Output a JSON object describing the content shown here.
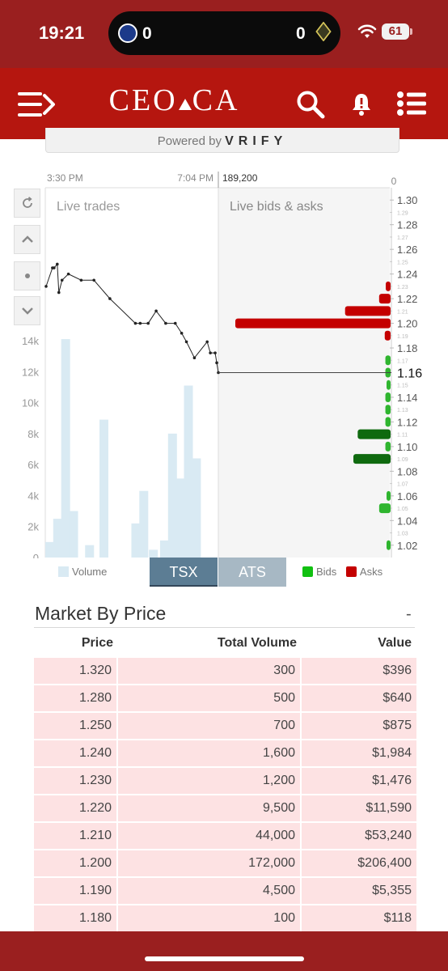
{
  "status_bar": {
    "time": "19:21",
    "score_left": "0",
    "score_right": "0",
    "battery": "61"
  },
  "app": {
    "logo_left": "CEO",
    "logo_right": "CA"
  },
  "powered_by": {
    "prefix": "Powered by",
    "brand": "VRIFY"
  },
  "chart": {
    "time_start": "3:30 PM",
    "time_end": "7:04 PM",
    "volume_readout": "189,200",
    "top_right_value": "0",
    "left_panel_label": "Live trades",
    "right_panel_label": "Live bids & asks",
    "current_price_label": "1.16",
    "volume_ticks": [
      "14k",
      "12k",
      "10k",
      "8k",
      "6k",
      "4k",
      "2k",
      "0"
    ],
    "price_ticks_major": [
      "1.30",
      "1.28",
      "1.26",
      "1.24",
      "1.22",
      "1.20",
      "1.18",
      "1.14",
      "1.12",
      "1.10",
      "1.08",
      "1.06",
      "1.04",
      "1.02"
    ],
    "price_ticks_minor": [
      "1.29",
      "1.27",
      "1.25",
      "1.23",
      "1.21",
      "1.19",
      "1.17",
      "1.15",
      "1.13",
      "1.11",
      "1.09",
      "1.07",
      "1.05",
      "1.03"
    ],
    "legend_volume": "Volume",
    "legend_bids": "Bids",
    "legend_asks": "Asks",
    "tab_tsx": "TSX",
    "tab_ats": "ATS",
    "colors": {
      "line": "#222222",
      "volume": "#d9eaf3",
      "bid": "#2fb52f",
      "bid_dark": "#0f6a0f",
      "ask": "#c40000",
      "tab_active": "#5c7d94",
      "tab_inactive": "#a7b8c4"
    }
  },
  "chart_data": {
    "type": "line",
    "price_series": {
      "x_minutes_after_1530": [
        0,
        8,
        10,
        14,
        16,
        20,
        28,
        44,
        60,
        80,
        112,
        118,
        128,
        138,
        150,
        162,
        170,
        176,
        186,
        202,
        206,
        212,
        214,
        216
      ],
      "price": [
        1.23,
        1.245,
        1.245,
        1.248,
        1.225,
        1.235,
        1.24,
        1.235,
        1.235,
        1.22,
        1.2,
        1.2,
        1.2,
        1.21,
        1.2,
        1.2,
        1.192,
        1.185,
        1.172,
        1.185,
        1.176,
        1.176,
        1.168,
        1.16
      ]
    },
    "volume_bars": {
      "x_minutes_after_1530": [
        4,
        14,
        24,
        34,
        54,
        72,
        112,
        122,
        134,
        148,
        158,
        168,
        178,
        188,
        198,
        208
      ],
      "volume": [
        1000,
        2500,
        14100,
        3000,
        800,
        8900,
        2200,
        4300,
        500,
        1100,
        8000,
        5100,
        11100,
        6400,
        0,
        0
      ]
    },
    "asks": [
      {
        "price": 1.23,
        "size": 1000
      },
      {
        "price": 1.22,
        "size": 9500
      },
      {
        "price": 1.21,
        "size": 44000
      },
      {
        "price": 1.2,
        "size": 172000
      },
      {
        "price": 1.19,
        "size": 4500
      }
    ],
    "bids": [
      {
        "price": 1.17,
        "size": 3000
      },
      {
        "price": 1.16,
        "size": 3000
      },
      {
        "price": 1.15,
        "size": 2000
      },
      {
        "price": 1.14,
        "size": 3000
      },
      {
        "price": 1.13,
        "size": 3000
      },
      {
        "price": 1.12,
        "size": 3000
      },
      {
        "price": 1.11,
        "size": 30000
      },
      {
        "price": 1.1,
        "size": 3000
      },
      {
        "price": 1.09,
        "size": 35000
      },
      {
        "price": 1.06,
        "size": 2000
      },
      {
        "price": 1.05,
        "size": 8000
      },
      {
        "price": 1.02,
        "size": 2000
      }
    ],
    "ylim_price": [
      1.01,
      1.31
    ],
    "ylim_volume": [
      0,
      14000
    ],
    "xlabel": "",
    "ylabel": ""
  },
  "market_by_price": {
    "title": "Market By Price",
    "collapse": "-",
    "headers": [
      "Price",
      "Total Volume",
      "Value"
    ],
    "rows": [
      [
        "1.320",
        "300",
        "$396"
      ],
      [
        "1.280",
        "500",
        "$640"
      ],
      [
        "1.250",
        "700",
        "$875"
      ],
      [
        "1.240",
        "1,600",
        "$1,984"
      ],
      [
        "1.230",
        "1,200",
        "$1,476"
      ],
      [
        "1.220",
        "9,500",
        "$11,590"
      ],
      [
        "1.210",
        "44,000",
        "$53,240"
      ],
      [
        "1.200",
        "172,000",
        "$206,400"
      ],
      [
        "1.190",
        "4,500",
        "$5,355"
      ],
      [
        "1.180",
        "100",
        "$118"
      ]
    ]
  }
}
